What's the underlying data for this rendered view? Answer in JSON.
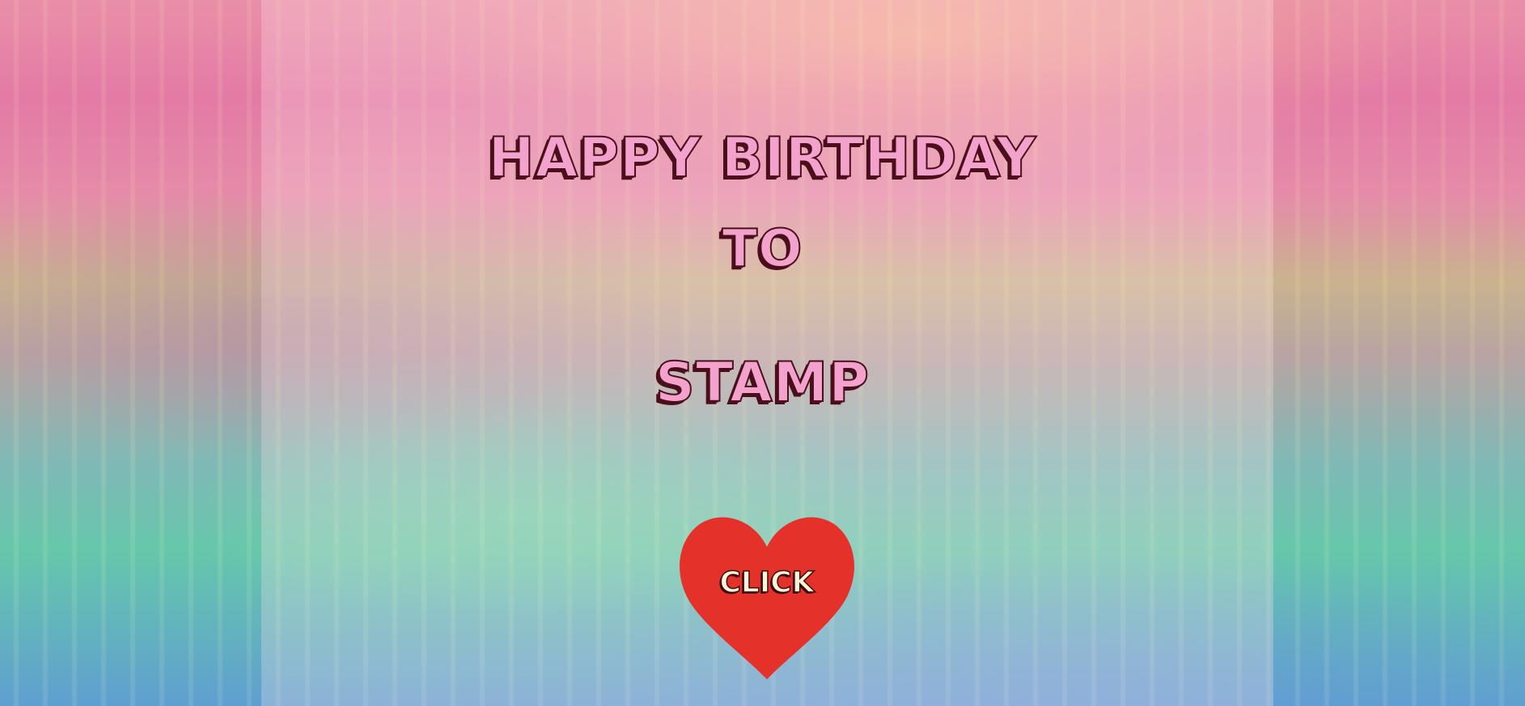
{
  "card": {
    "line1": "HAPPY BIRTHDAY",
    "line2": "TO",
    "line3": "STAMP"
  },
  "button": {
    "label": "CLICK",
    "icon": "heart-icon",
    "color": "#e4312a"
  },
  "colors": {
    "title_fill": "#f2a2cc",
    "title_outline": "#4a0f1a"
  }
}
